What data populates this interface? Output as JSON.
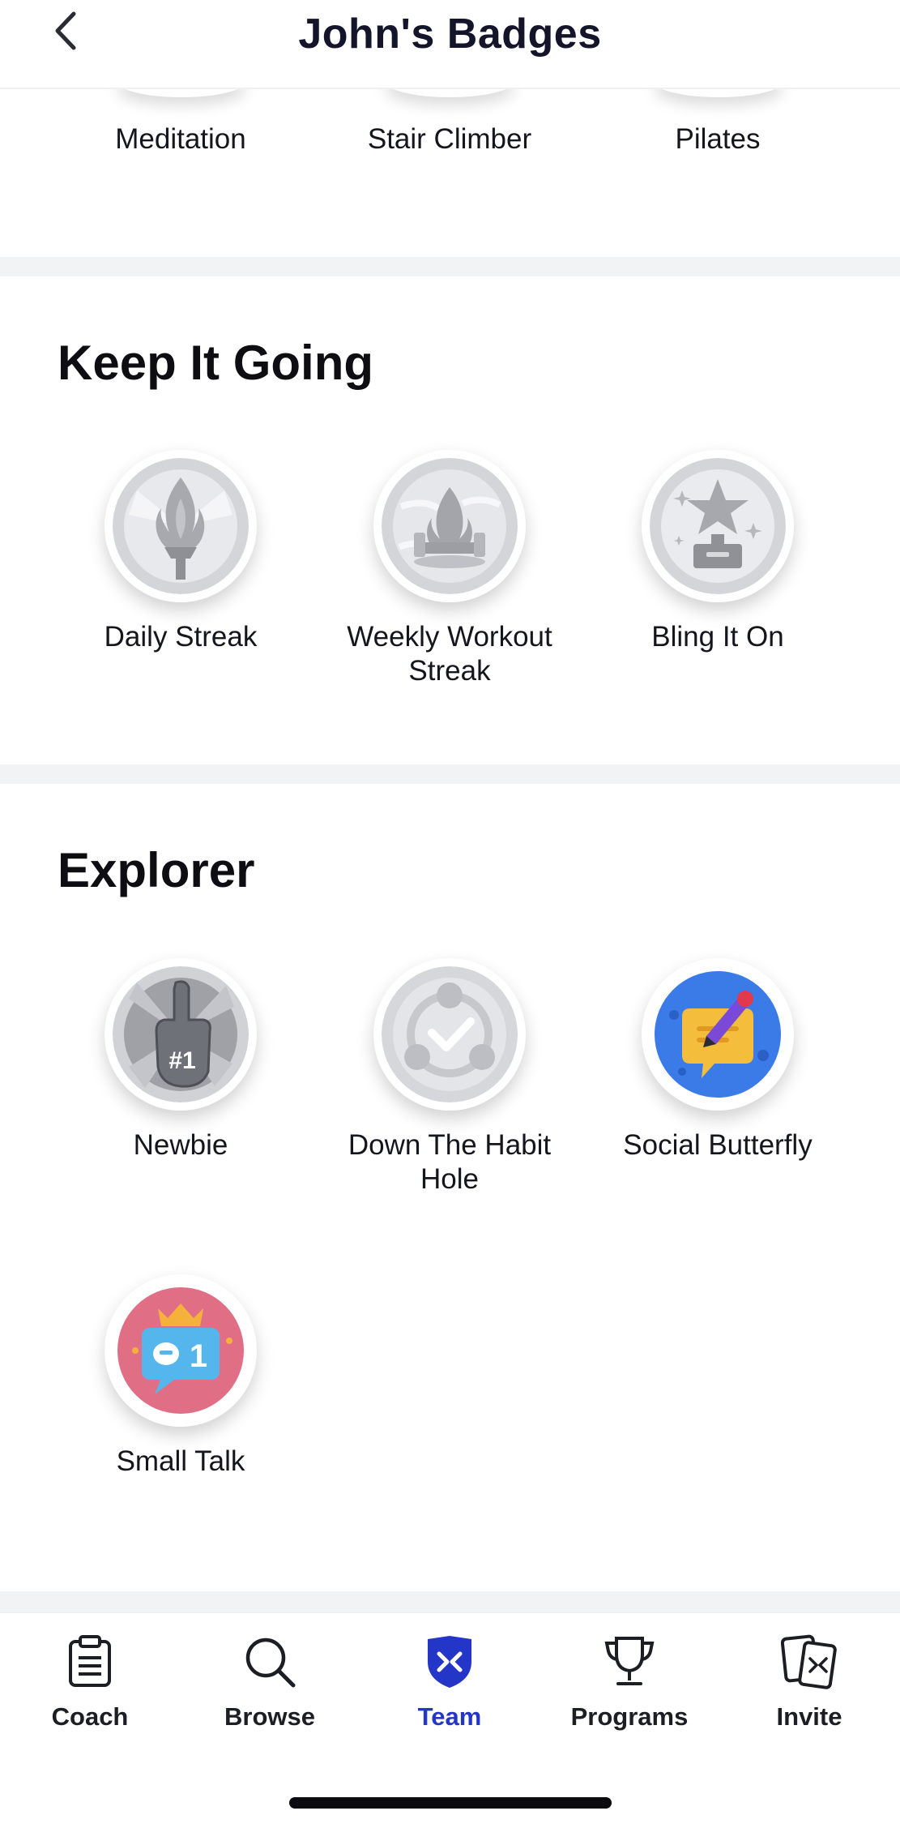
{
  "header": {
    "title": "John's Badges"
  },
  "top_partial": {
    "labels": [
      "Meditation",
      "Stair Climber",
      "Pilates"
    ]
  },
  "sections": [
    {
      "title": "Keep It Going",
      "badges": [
        {
          "label": "Daily Streak",
          "icon": "torch-icon",
          "earned": false
        },
        {
          "label": "Weekly Workout Streak",
          "icon": "campfire-icon",
          "earned": false
        },
        {
          "label": "Bling It On",
          "icon": "star-trophy-icon",
          "earned": false
        }
      ]
    },
    {
      "title": "Explorer",
      "badges": [
        {
          "label": "Newbie",
          "icon": "foam-finger-icon",
          "earned": false
        },
        {
          "label": "Down The Habit Hole",
          "icon": "habit-cycle-icon",
          "earned": false
        },
        {
          "label": "Social Butterfly",
          "icon": "pen-note-icon",
          "earned": true
        },
        {
          "label": "Small Talk",
          "icon": "chat-crown-icon",
          "earned": true
        }
      ]
    }
  ],
  "nav": {
    "items": [
      {
        "label": "Coach",
        "icon": "clipboard-icon",
        "active": false
      },
      {
        "label": "Browse",
        "icon": "search-icon",
        "active": false
      },
      {
        "label": "Team",
        "icon": "shield-icon",
        "active": true
      },
      {
        "label": "Programs",
        "icon": "trophy-icon",
        "active": false
      },
      {
        "label": "Invite",
        "icon": "cards-icon",
        "active": false
      }
    ]
  },
  "colors": {
    "accent": "#2436c8",
    "locked_gray": "#c9cbd0",
    "divider": "#f2f3f5",
    "social_butterfly_bg": "#3b7be8",
    "small_talk_bg": "#e06f86"
  }
}
